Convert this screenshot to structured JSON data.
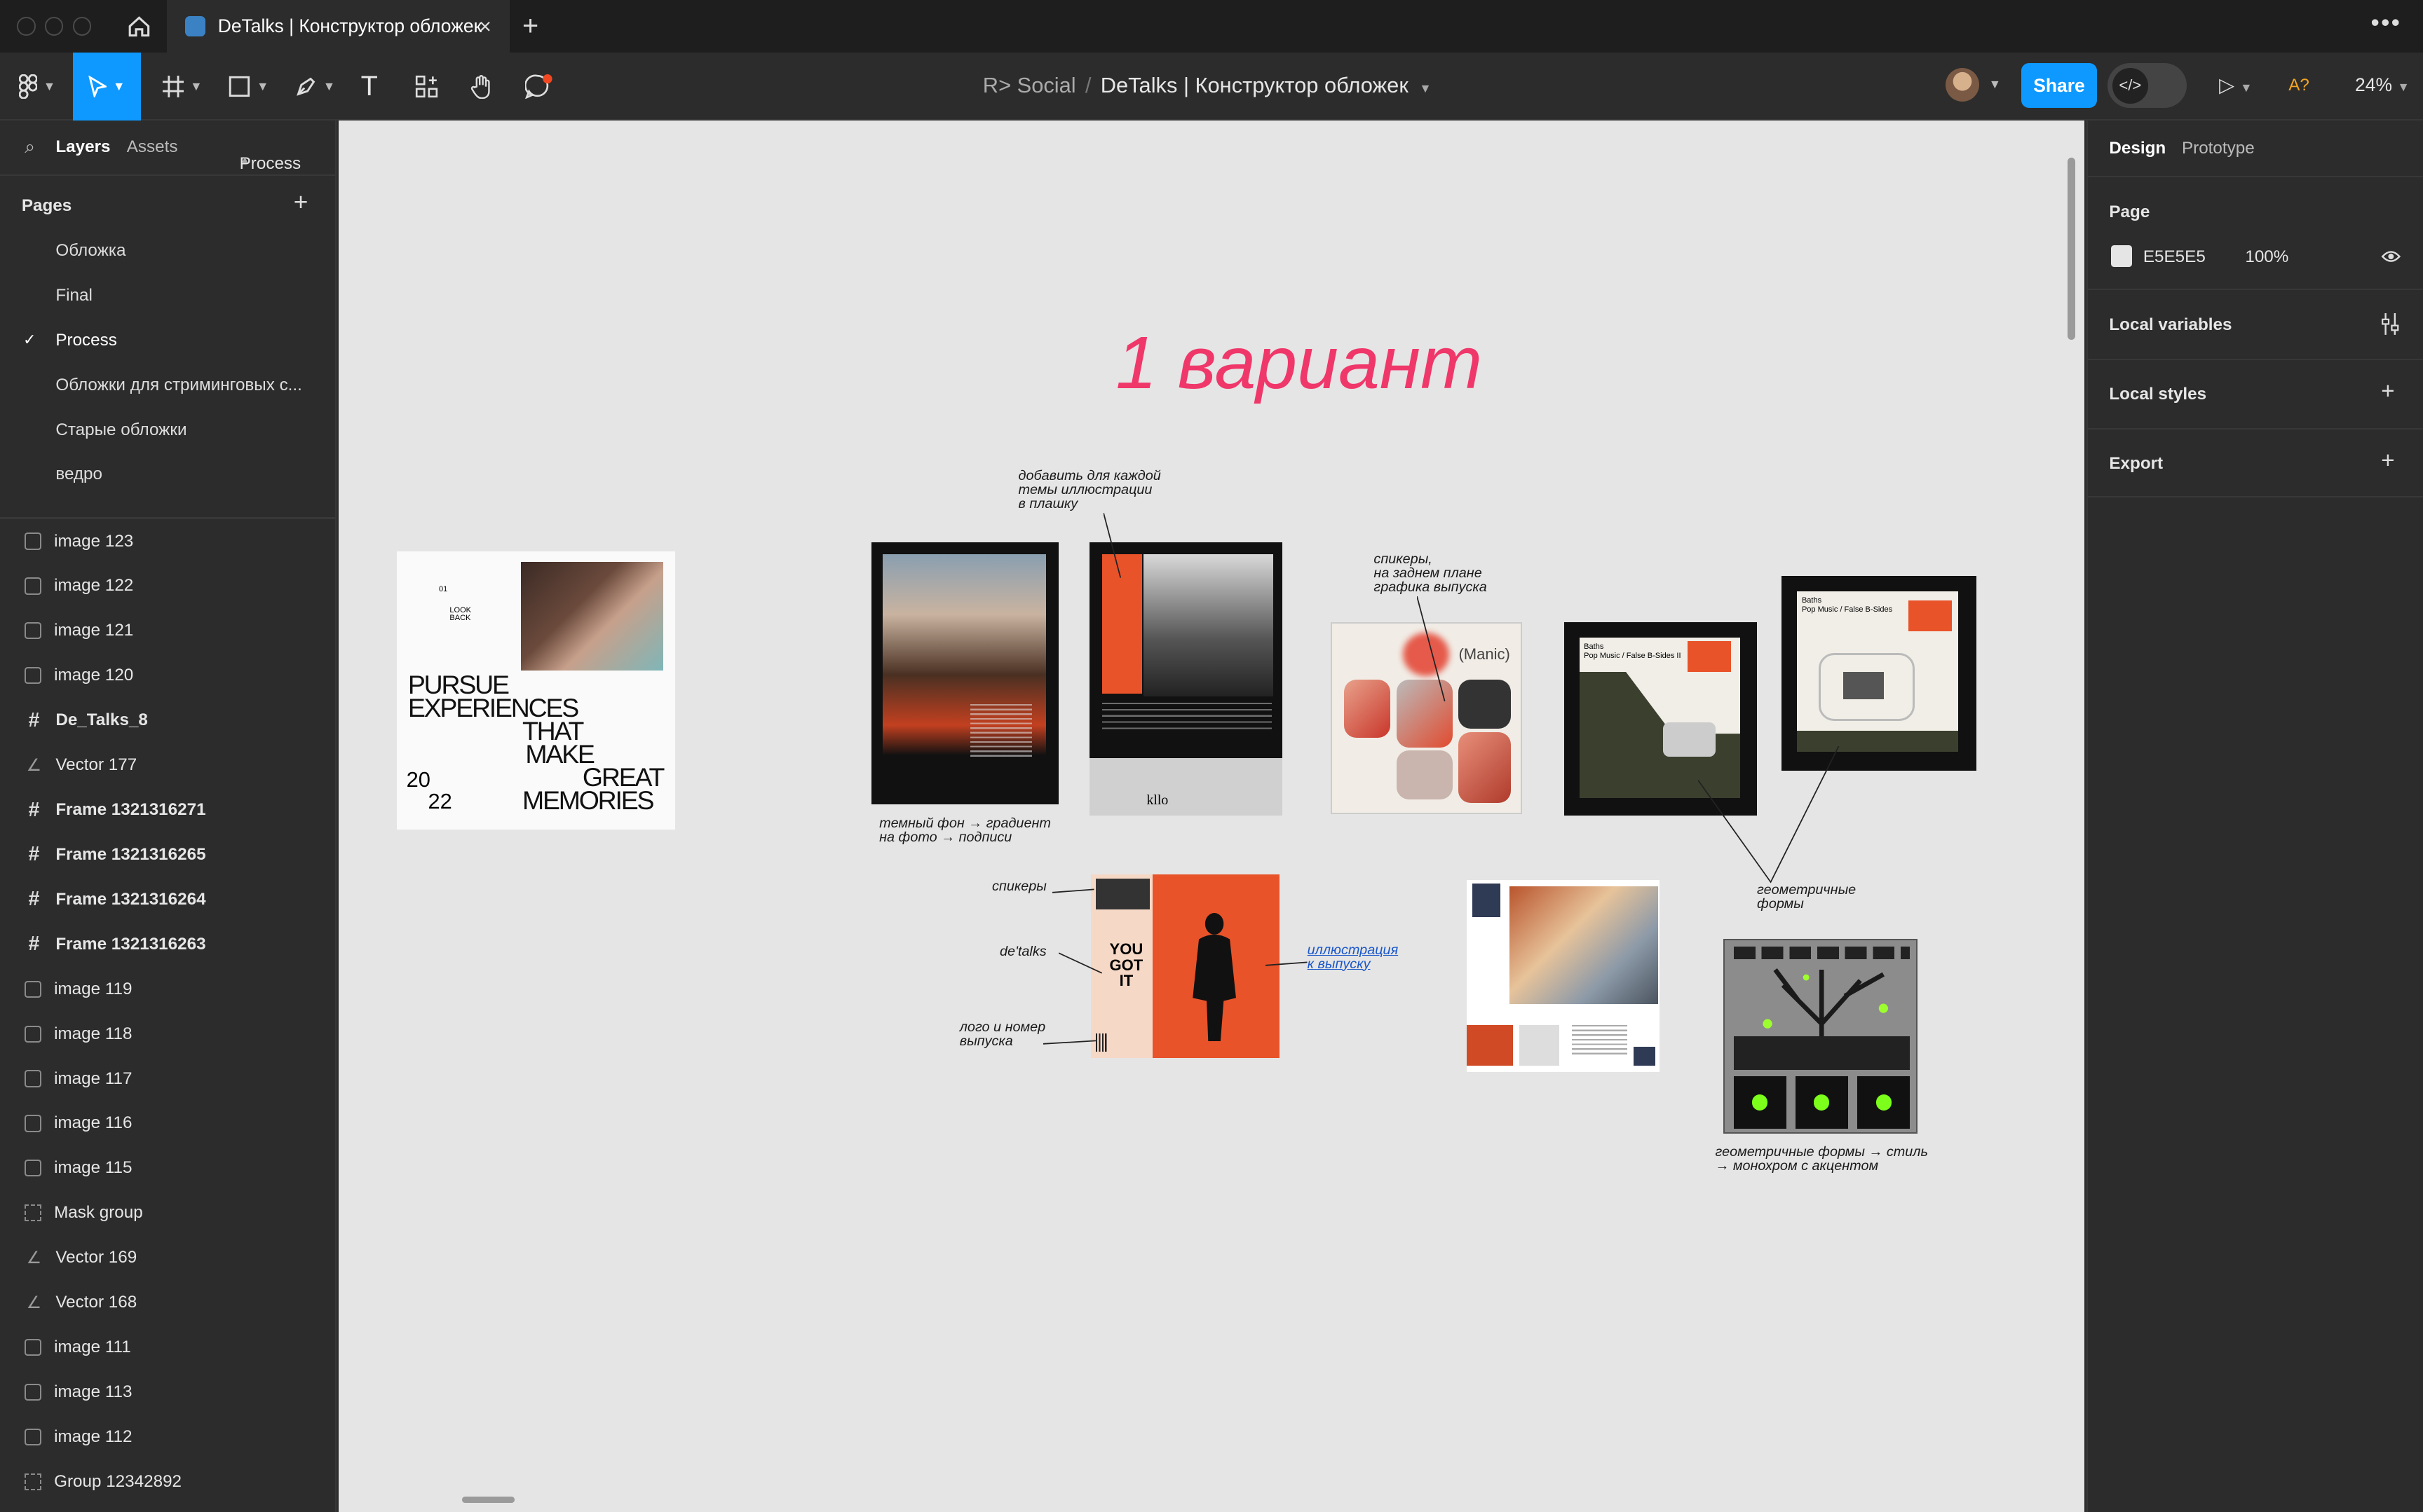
{
  "titlebar": {
    "tab_title": "DeTalks | Конструктор обложек"
  },
  "toolbar": {
    "project": "R> Social",
    "separator": "/",
    "file_name": "DeTalks | Конструктор обложек",
    "share_label": "Share",
    "zoom": "24%",
    "font_warning": "A?"
  },
  "left_panel": {
    "tabs": {
      "layers": "Layers",
      "assets": "Assets",
      "page_switch": "Process"
    },
    "pages_title": "Pages",
    "pages": [
      "Обложка",
      "Final",
      "Process",
      "Обложки для стриминговых с...",
      "Старые обложки",
      "ведро"
    ],
    "current_page": "Process",
    "layers": [
      {
        "name": "image 123",
        "type": "image"
      },
      {
        "name": "image 122",
        "type": "image"
      },
      {
        "name": "image 121",
        "type": "image"
      },
      {
        "name": "image 120",
        "type": "image"
      },
      {
        "name": "De_Talks_8",
        "type": "frame"
      },
      {
        "name": "Vector 177",
        "type": "vector"
      },
      {
        "name": "Frame 1321316271",
        "type": "frame"
      },
      {
        "name": "Frame 1321316265",
        "type": "frame"
      },
      {
        "name": "Frame 1321316264",
        "type": "frame"
      },
      {
        "name": "Frame 1321316263",
        "type": "frame"
      },
      {
        "name": "image 119",
        "type": "image"
      },
      {
        "name": "image 118",
        "type": "image"
      },
      {
        "name": "image 117",
        "type": "image"
      },
      {
        "name": "image 116",
        "type": "image"
      },
      {
        "name": "image 115",
        "type": "image"
      },
      {
        "name": "Mask group",
        "type": "group"
      },
      {
        "name": "Vector 169",
        "type": "vector"
      },
      {
        "name": "Vector 168",
        "type": "vector"
      },
      {
        "name": "image 111",
        "type": "image"
      },
      {
        "name": "image 113",
        "type": "image"
      },
      {
        "name": "image 112",
        "type": "image"
      },
      {
        "name": "Group 12342892",
        "type": "group"
      }
    ]
  },
  "canvas": {
    "heading": "1 вариант",
    "notes": {
      "add_illustration": "добавить для каждой\nтемы иллюстрации\nв плашку",
      "speakers_bg": "спикеры,\nна заднем плане\nграфика выпуска",
      "dark_bg": "темный фон → градиент\nна фото → подписи",
      "speakers": "спикеры",
      "detalks": "de'talks",
      "logo_number": "лого и номер\nвыпуска",
      "illustration": "иллюстрация\nк выпуску",
      "geometric": "геометричные\nформы",
      "geometric_style": "геометричные формы → стиль\n→ монохром с акцентом"
    },
    "poster_text": {
      "pursue_top": "PURSUE",
      "experiences": "EXPERIENCES",
      "that": "THAT",
      "make": "MAKE",
      "great": "GREAT",
      "memories": "MEMORIES",
      "year_a": "20",
      "year_b": "22",
      "num": "01",
      "lookback": "LOOK\nBACK",
      "kilo": "kllo",
      "manic": "(Manic)",
      "baths": "Baths",
      "album_a": "Pop Music / False B-Sides II",
      "album_b": "Pop Music / False B-Sides",
      "yougotit": "YOU\nGOT\nIT"
    }
  },
  "right_panel": {
    "tabs": {
      "design": "Design",
      "prototype": "Prototype"
    },
    "page_label": "Page",
    "page_color": "E5E5E5",
    "page_opacity": "100%",
    "local_variables": "Local variables",
    "local_styles": "Local styles",
    "export": "Export"
  },
  "colors": {
    "accent": "#0d99ff",
    "heading": "#f0376a",
    "canvas_bg": "#e5e5e5",
    "panel_bg": "#2c2c2c"
  }
}
